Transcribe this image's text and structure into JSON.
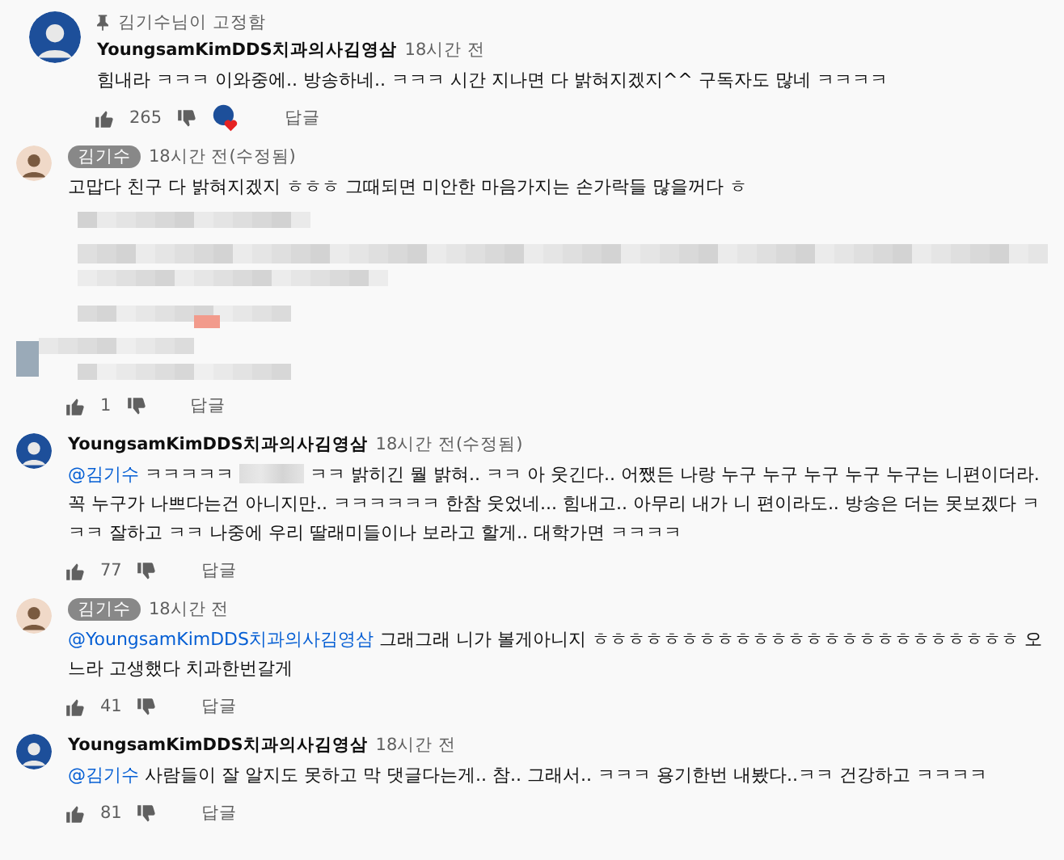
{
  "comments": [
    {
      "kind": "comment",
      "pinned_label": "김기수님이 고정함",
      "author": "YoungsamKimDDS치과의사김영삼",
      "is_owner": false,
      "time": "18시간 전",
      "body": [
        {
          "kind": "text",
          "text": "힘내라 ㅋㅋㅋ 이와중에.. 방송하네.. ㅋㅋㅋ 시간 지나면 다 밝혀지겠지^^ 구독자도 많네 ㅋㅋㅋㅋ"
        }
      ],
      "likes": "265",
      "hearted": true,
      "reply_label": "답글"
    },
    {
      "kind": "comment",
      "author": "김기수",
      "is_owner": true,
      "time": "18시간 전(수정됨)",
      "body": [
        {
          "kind": "text",
          "text": "고맙다 친구 다 밝혀지겠지 ㅎㅎㅎ 그때되면 미안한 마음가지는 손가락들 많을꺼다 ㅎ"
        }
      ]
    },
    {
      "kind": "blurred",
      "likes": "1",
      "reply_label": "답글"
    },
    {
      "kind": "comment",
      "author": "YoungsamKimDDS치과의사김영삼",
      "is_owner": false,
      "time": "18시간 전(수정됨)",
      "body": [
        {
          "kind": "mention",
          "text": "@김기수"
        },
        {
          "kind": "text",
          "text": " ㅋㅋㅋㅋㅋ "
        },
        {
          "kind": "redacted"
        },
        {
          "kind": "text",
          "text": " ㅋㅋ 밝히긴 뭘 밝혀.. ㅋㅋ 아 웃긴다.. 어쨌든 나랑 누구 누구 누구 누구 누구는 니편이더라. 꼭 누구가 나쁘다는건 아니지만.. ㅋㅋㅋㅋㅋㅋ 한참 웃었네... 힘내고.. 아무리 내가 니 편이라도.. 방송은 더는 못보겠다 ㅋㅋㅋ 잘하고 ㅋㅋ 나중에 우리 딸래미들이나 보라고 할게.. 대학가면 ㅋㅋㅋㅋ"
        }
      ],
      "likes": "77",
      "reply_label": "답글"
    },
    {
      "kind": "comment",
      "author": "김기수",
      "is_owner": true,
      "time": "18시간 전",
      "body": [
        {
          "kind": "mention",
          "text": "@YoungsamKimDDS치과의사김영삼"
        },
        {
          "kind": "text",
          "text": "  그래그래 니가 볼게아니지 ㅎㅎㅎㅎㅎㅎㅎㅎㅎㅎㅎㅎㅎㅎㅎㅎㅎㅎㅎㅎㅎㅎㅎㅎ 오느라 고생했다 치과한번갈게"
        }
      ],
      "likes": "41",
      "reply_label": "답글"
    },
    {
      "kind": "comment",
      "author": "YoungsamKimDDS치과의사김영삼",
      "is_owner": false,
      "time": "18시간 전",
      "body": [
        {
          "kind": "mention",
          "text": "@김기수"
        },
        {
          "kind": "text",
          "text": " 사람들이 잘 알지도 못하고 막 댓글다는게.. 참.. 그래서.. ㅋㅋㅋ 용기한번 내봤다..ㅋㅋ 건강하고 ㅋㅋㅋㅋ"
        }
      ],
      "likes": "81",
      "reply_label": "답글"
    }
  ]
}
